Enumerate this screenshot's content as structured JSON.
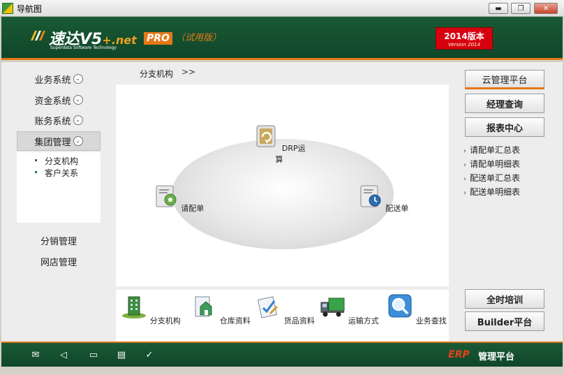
{
  "window": {
    "title": "导航图",
    "minimize": "▬",
    "maximize": "❐",
    "close": "✕"
  },
  "header": {
    "logo_name": "速达V5",
    "logo_suffix": "+.net",
    "logo_sub": "Superdata Software Technology",
    "edition": "PRO",
    "trial": "（试用版）",
    "version_main": "2014版本",
    "version_sub": "Version 2014"
  },
  "nav": {
    "items": [
      {
        "label": "业务系统"
      },
      {
        "label": "资金系统"
      },
      {
        "label": "账务系统"
      },
      {
        "label": "集团管理"
      }
    ],
    "subitems": [
      {
        "label": "分支机构"
      },
      {
        "label": "客户关系"
      }
    ],
    "extra": [
      {
        "label": "分销管理"
      },
      {
        "label": "网店管理"
      }
    ]
  },
  "breadcrumb": {
    "label": "分支机构",
    "arrow": ">>"
  },
  "diagram": {
    "nodes": [
      {
        "label": "DRP运算",
        "icon": "refresh-box-icon"
      },
      {
        "label": "请配单",
        "icon": "gear-document-icon"
      },
      {
        "label": "配送单",
        "icon": "clock-document-icon"
      }
    ]
  },
  "shortcuts": [
    {
      "label": "分支机构",
      "icon": "building-icon"
    },
    {
      "label": "仓库资料",
      "icon": "warehouse-icon"
    },
    {
      "label": "货品资料",
      "icon": "goods-doc-icon"
    },
    {
      "label": "运输方式",
      "icon": "truck-icon"
    },
    {
      "label": "业务查找",
      "icon": "search-icon"
    }
  ],
  "right": {
    "buttons_top": [
      {
        "label": "云管理平台"
      },
      {
        "label": "经理查询"
      },
      {
        "label": "报表中心"
      }
    ],
    "links": [
      {
        "label": "请配单汇总表"
      },
      {
        "label": "请配单明细表"
      },
      {
        "label": "配送单汇总表"
      },
      {
        "label": "配送单明细表"
      }
    ],
    "buttons_bottom": [
      {
        "label": "全时培训"
      },
      {
        "label": "Builder平台"
      }
    ]
  },
  "footer": {
    "icons": [
      "mail-icon",
      "speaker-icon",
      "book-icon",
      "copy-icon",
      "check-icon"
    ],
    "erp": "ERP",
    "title": "管理平台"
  },
  "colors": {
    "brand_green": "#1a5a36",
    "accent_orange": "#e67817",
    "version_red": "#d7000f"
  }
}
